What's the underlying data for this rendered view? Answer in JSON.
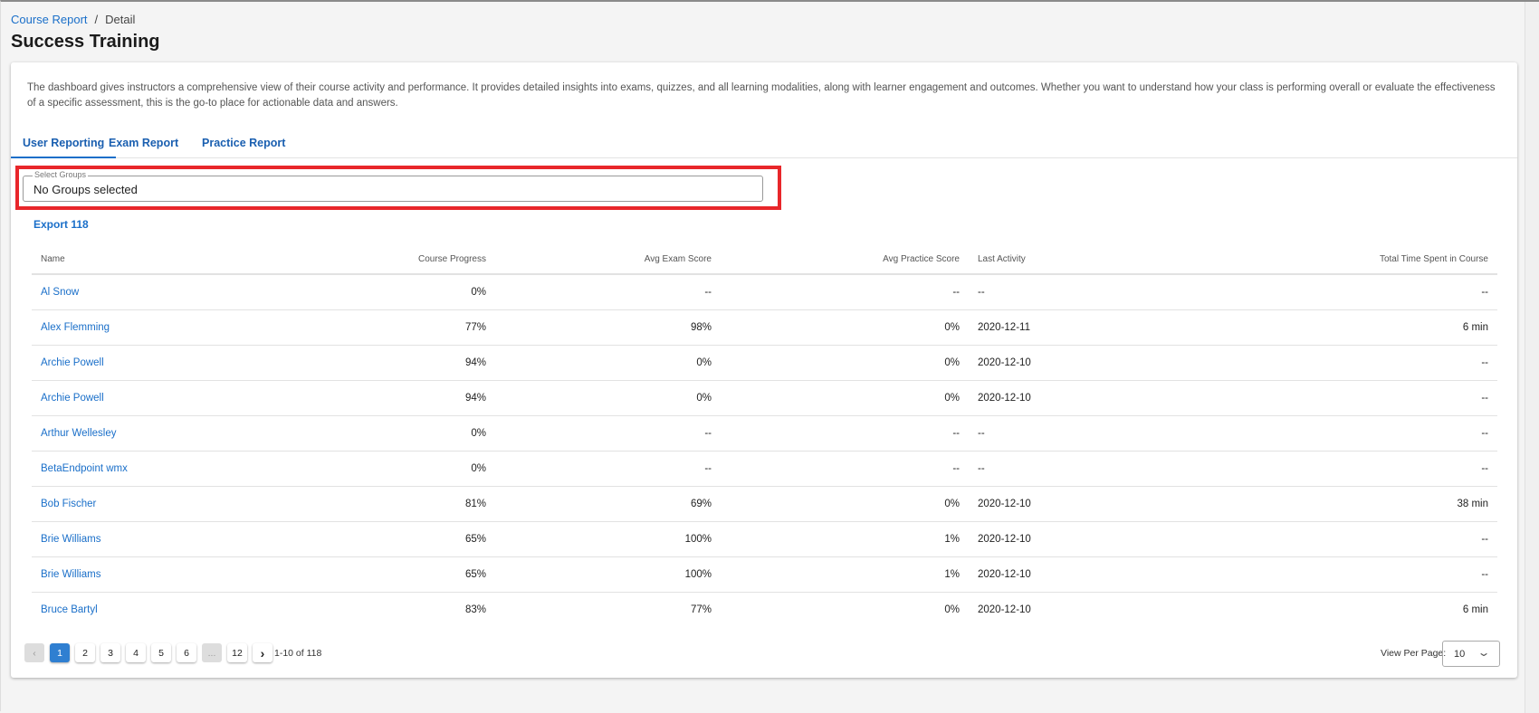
{
  "breadcrumb": {
    "parent": "Course Report",
    "separator": "/",
    "current": "Detail"
  },
  "page_title": "Success Training",
  "description": "The dashboard gives instructors a comprehensive view of their course activity and performance. It provides detailed insights into exams, quizzes, and all learning modalities, along with learner engagement and outcomes. Whether you want to understand how your class is performing overall or evaluate the effectiveness of a specific assessment, this is the go-to place for actionable data and answers.",
  "tabs": [
    {
      "label": "User Reporting",
      "active": true
    },
    {
      "label": "Exam Report"
    },
    {
      "label": "Practice Report"
    }
  ],
  "select_groups": {
    "label": "Select Groups",
    "value": "No Groups selected"
  },
  "export_label": "Export 118",
  "table": {
    "headers": [
      "Name",
      "Course Progress",
      "Avg Exam Score",
      "Avg Practice Score",
      "Last Activity",
      "Total Time Spent in Course"
    ],
    "rows": [
      [
        "Al Snow",
        "0%",
        "--",
        "--",
        "--",
        "--"
      ],
      [
        "Alex Flemming",
        "77%",
        "98%",
        "0%",
        "2020-12-11",
        "6 min"
      ],
      [
        "Archie Powell",
        "94%",
        "0%",
        "0%",
        "2020-12-10",
        "--"
      ],
      [
        "Archie Powell",
        "94%",
        "0%",
        "0%",
        "2020-12-10",
        "--"
      ],
      [
        "Arthur Wellesley",
        "0%",
        "--",
        "--",
        "--",
        "--"
      ],
      [
        "BetaEndpoint wmx",
        "0%",
        "--",
        "--",
        "--",
        "--"
      ],
      [
        "Bob Fischer",
        "81%",
        "69%",
        "0%",
        "2020-12-10",
        "38 min"
      ],
      [
        "Brie Williams",
        "65%",
        "100%",
        "1%",
        "2020-12-10",
        "--"
      ],
      [
        "Brie Williams",
        "65%",
        "100%",
        "1%",
        "2020-12-10",
        "--"
      ],
      [
        "Bruce Bartyl",
        "83%",
        "77%",
        "0%",
        "2020-12-10",
        "6 min"
      ]
    ]
  },
  "pagination": {
    "prev": "‹",
    "pages": [
      "1",
      "2",
      "3",
      "4",
      "5",
      "6",
      "...",
      "12"
    ],
    "current": "1",
    "next": "›",
    "range": "1-10 of 118"
  },
  "view_per_page": {
    "label": "View Per Page:",
    "value": "10",
    "chevron": "⌄"
  },
  "colors": {
    "accent": "#1a6fc9",
    "highlight": "#e8262a",
    "active_page": "#2f7fd1"
  }
}
